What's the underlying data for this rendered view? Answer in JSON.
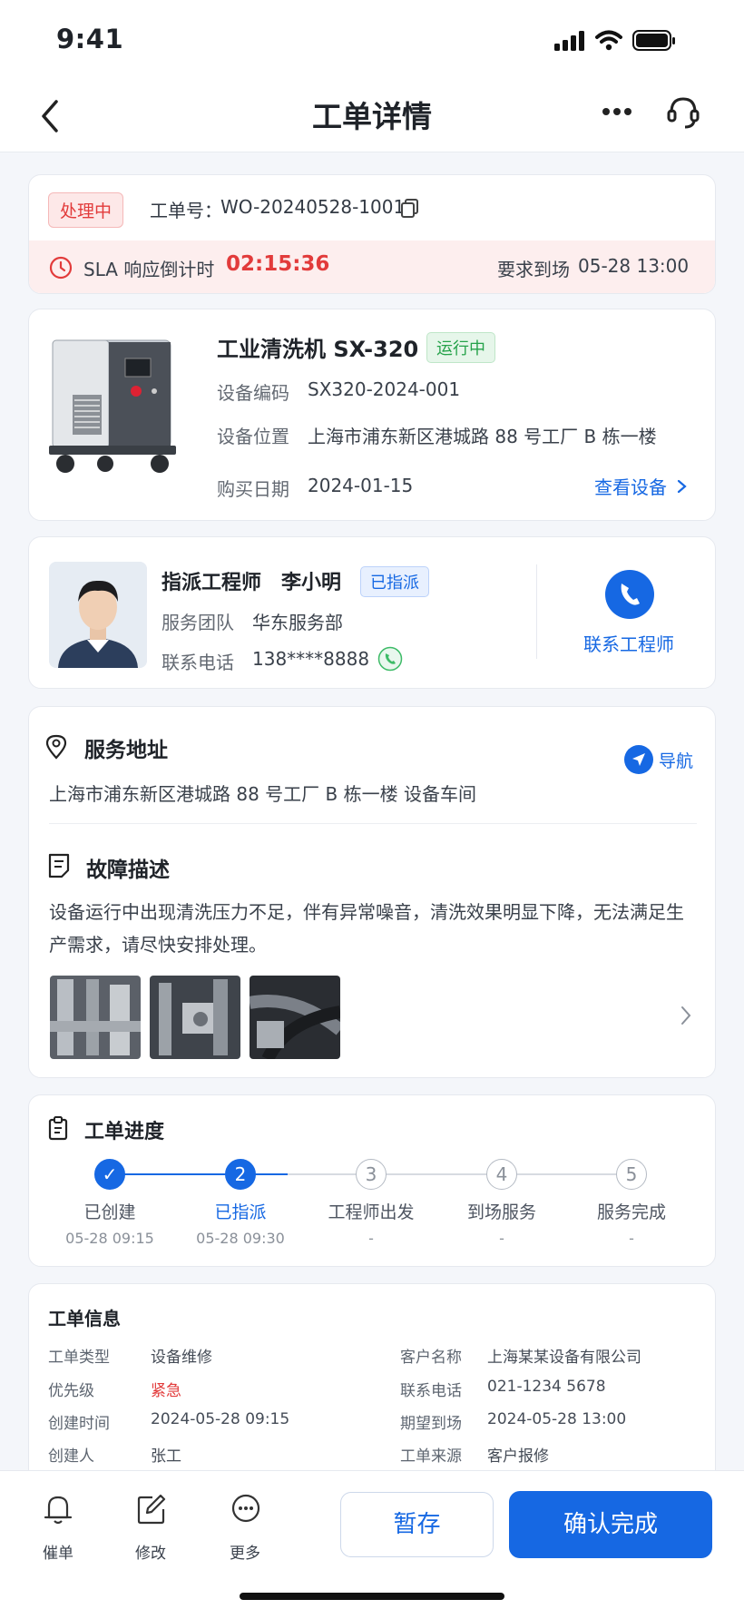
{
  "status_bar": {
    "time": "9:41"
  },
  "nav": {
    "title": "工单详情"
  },
  "order": {
    "status": "处理中",
    "number_label": "工单号：",
    "number": "WO-20240528-1001",
    "sla_label": "SLA 响应倒计时",
    "sla_countdown": "02:15:36",
    "arrival_label": "要求到场",
    "arrival_time": "05-28 13:00"
  },
  "equipment": {
    "name": "工业清洗机 SX-320",
    "state": "运行中",
    "code_label": "设备编码",
    "code": "SX320-2024-001",
    "location_label": "设备位置",
    "location": "上海市浦东新区港城路 88 号工厂 B 栋一楼",
    "purchase_label": "购买日期",
    "purchase_date": "2024-01-15",
    "view_link": "查看设备",
    "image_icon": "industrial-washer-image"
  },
  "engineer": {
    "title_label": "指派工程师",
    "name": "李小明",
    "badge": "已指派",
    "team_label": "服务团队",
    "team": "华东服务部",
    "phone_label": "联系电话",
    "phone": "138****8888",
    "contact_button": "联系工程师"
  },
  "service": {
    "address_title": "服务地址",
    "address": "上海市浦东新区港城路 88 号工厂  B 栋一楼 设备车间",
    "navigate": "导航",
    "fault_title": "故障描述",
    "fault_line1": "设备运行中出现清洗压力不足，伴有异常噪音，清洗效果明显下降，无法满足生",
    "fault_line2": "产需求，请尽快安排处理。"
  },
  "progress": {
    "title": "工单进度",
    "steps": [
      {
        "num": "✓",
        "label": "已创建",
        "time": "05-28 09:15"
      },
      {
        "num": "2",
        "label": "已指派",
        "time": "05-28 09:30"
      },
      {
        "num": "3",
        "label": "工程师出发",
        "time": "-"
      },
      {
        "num": "4",
        "label": "到场服务",
        "time": "-"
      },
      {
        "num": "5",
        "label": "服务完成",
        "time": "-"
      }
    ]
  },
  "info": {
    "title": "工单信息",
    "rows": [
      {
        "k1": "工单类型",
        "v1": "设备维修",
        "k2": "客户名称",
        "v2": "上海某某设备有限公司"
      },
      {
        "k1": "优先级",
        "v1": "紧急",
        "k2": "联系电话",
        "v2": "021-1234 5678"
      },
      {
        "k1": "创建时间",
        "v1": "2024-05-28 09:15",
        "k2": "期望到场",
        "v2": "2024-05-28 13:00"
      },
      {
        "k1": "创建人",
        "v1": "张工",
        "k2": "工单来源",
        "v2": "客户报修"
      }
    ]
  },
  "bottom_bar": {
    "remind": "催单",
    "edit": "修改",
    "more": "更多",
    "save": "暂存",
    "confirm": "确认完成"
  },
  "colors": {
    "primary": "#1668e3",
    "danger": "#e23b3b",
    "success": "#25a24a",
    "background": "#f4f6fa"
  }
}
